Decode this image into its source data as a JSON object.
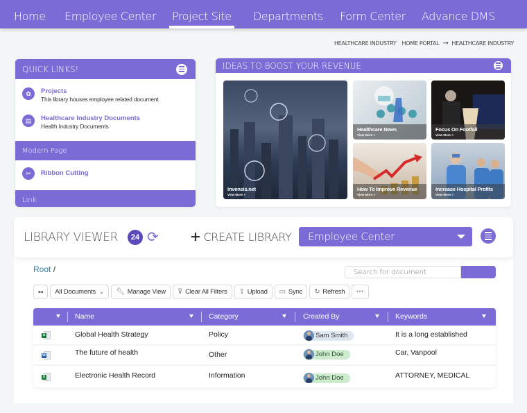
{
  "nav": {
    "items": [
      {
        "label": "Home",
        "active": false
      },
      {
        "label": "Employee Center",
        "active": false
      },
      {
        "label": "Project Site",
        "active": true
      },
      {
        "label": "Departments",
        "active": false
      },
      {
        "label": "Form Center",
        "active": false
      },
      {
        "label": "Advance DMS",
        "active": false
      }
    ]
  },
  "breadcrumb": {
    "first": "HEALTHCARE INDUSTRY",
    "second": "HOME PORTAL",
    "arrow": "→",
    "third": "HEALTHCARE INDUSTRY"
  },
  "quick_links": {
    "title": "QUICK LINKS!",
    "items": [
      {
        "title": "Projects",
        "subtitle": "This library houses employee related document",
        "icon": "projects-icon"
      },
      {
        "title": "Healthcare Industry Documents",
        "subtitle": "Health Industry Documents",
        "icon": "document-icon"
      }
    ],
    "section_modern": "Modern Page",
    "modern_items": [
      {
        "title": "Ribbon Cutting",
        "icon": "ribbon-cutting-icon"
      }
    ],
    "section_link": "Link"
  },
  "ideas": {
    "title": "IDEAS TO BOOST YOUR REVENUE",
    "view_more": "View More >",
    "tiles": [
      {
        "title": "Invensis.net"
      },
      {
        "title": "Healthcare News"
      },
      {
        "title": "Focus On Footfall"
      },
      {
        "title": "How To Improve Revenue"
      },
      {
        "title": "Increase Hospital Profits"
      }
    ]
  },
  "library": {
    "title": "LIBRARY VIEWER",
    "count": "24",
    "create_label": "CREATE LIBRARY",
    "selected_library": "Employee Center",
    "root_label": "Root",
    "root_sep": "/",
    "search_placeholder": "Search for document",
    "toolbar": {
      "view_select": "All Documents",
      "manage_view": "Manage View",
      "clear_filters": "Clear All Filters",
      "upload": "Upload",
      "sync": "Sync",
      "refresh": "Refresh",
      "more": "•••"
    },
    "columns": [
      "Name",
      "Category",
      "Created By",
      "Keywords"
    ],
    "rows": [
      {
        "type": "excel",
        "name": "Global Health Strategy",
        "category": "Policy",
        "created_by": "Sam Smith",
        "keywords": "It is a long established"
      },
      {
        "type": "word",
        "name": "The future of health",
        "category": "Other",
        "created_by": "John Doe",
        "keywords": "Car, Vanpool"
      },
      {
        "type": "excel",
        "name": "Electronic Health Record",
        "category": "Information",
        "created_by": "John Doe",
        "keywords": "ATTORNEY, MEDICAL"
      }
    ]
  },
  "colors": {
    "accent": "#7b6bd6",
    "badge": "#5a4bbd",
    "link": "#2f7ea6",
    "excel": "#1f7a3e",
    "word": "#2b5cab"
  }
}
